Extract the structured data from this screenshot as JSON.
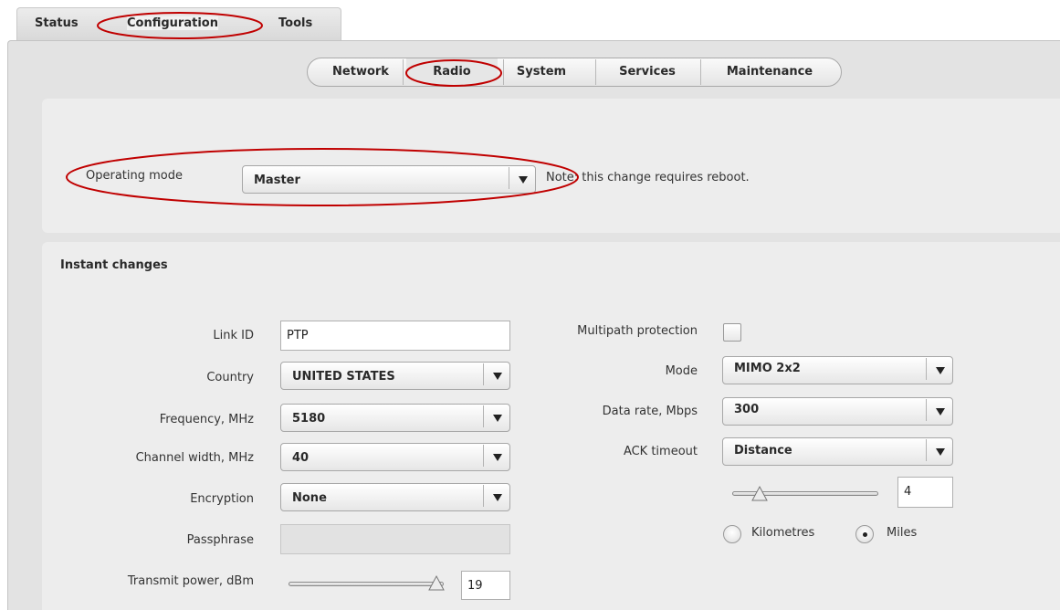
{
  "top_tabs": {
    "status": "Status",
    "configuration": "Configuration",
    "tools": "Tools"
  },
  "subnav": {
    "network": "Network",
    "radio": "Radio",
    "system": "System",
    "services": "Services",
    "maintenance": "Maintenance"
  },
  "operating_mode": {
    "label": "Operating mode",
    "value": "Master",
    "note": "Note: this change requires reboot."
  },
  "instant": {
    "title": "Instant changes",
    "link_id": {
      "label": "Link ID",
      "value": "PTP"
    },
    "country": {
      "label": "Country",
      "value": "UNITED STATES"
    },
    "frequency": {
      "label": "Frequency, MHz",
      "value": "5180"
    },
    "channel_width": {
      "label": "Channel width, MHz",
      "value": "40"
    },
    "encryption": {
      "label": "Encryption",
      "value": "None"
    },
    "passphrase": {
      "label": "Passphrase",
      "value": ""
    },
    "transmit_power": {
      "label": "Transmit power, dBm",
      "value": "19"
    },
    "multipath": {
      "label": "Multipath protection",
      "checked": false
    },
    "mode": {
      "label": "Mode",
      "value": "MIMO 2x2"
    },
    "data_rate": {
      "label": "Data rate, Mbps",
      "value": "300"
    },
    "ack_timeout": {
      "label": "ACK timeout",
      "value": "Distance",
      "distance_value": "4"
    },
    "units": {
      "kilometres": "Kilometres",
      "miles": "Miles",
      "selected": "Miles"
    }
  },
  "colors": {
    "annotation": "#c00000",
    "panel": "#ededed",
    "background": "#e3e3e3"
  }
}
